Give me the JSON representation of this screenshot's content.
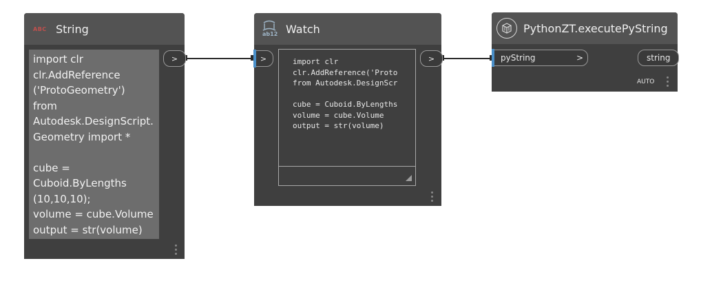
{
  "nodes": {
    "string": {
      "title": "String",
      "icon_text": "ABC",
      "output_port": ">",
      "content": "import clr\nclr.AddReference\n('ProtoGeometry')\nfrom\nAutodesk.DesignScript.\nGeometry import *\n\ncube =\nCuboid.ByLengths\n(10,10,10);\nvolume = cube.Volume\noutput = str(volume)"
    },
    "watch": {
      "title": "Watch",
      "icon_text": "ab12",
      "input_port": ">",
      "output_port": ">",
      "content": "import clr\nclr.AddReference('Proto\nfrom Autodesk.DesignScr\n\ncube = Cuboid.ByLengths\nvolume = cube.Volume\noutput = str(volume)"
    },
    "python": {
      "title": "PythonZT.executePyString",
      "input_port_label": "pyString",
      "input_port_arrow": ">",
      "output_port_label": "string",
      "lacing": "AUTO"
    }
  },
  "colors": {
    "node_body": "#3f3f3f",
    "node_header": "#535353",
    "port_accent": "#4a8fc8",
    "icon_red": "#c0504d"
  }
}
